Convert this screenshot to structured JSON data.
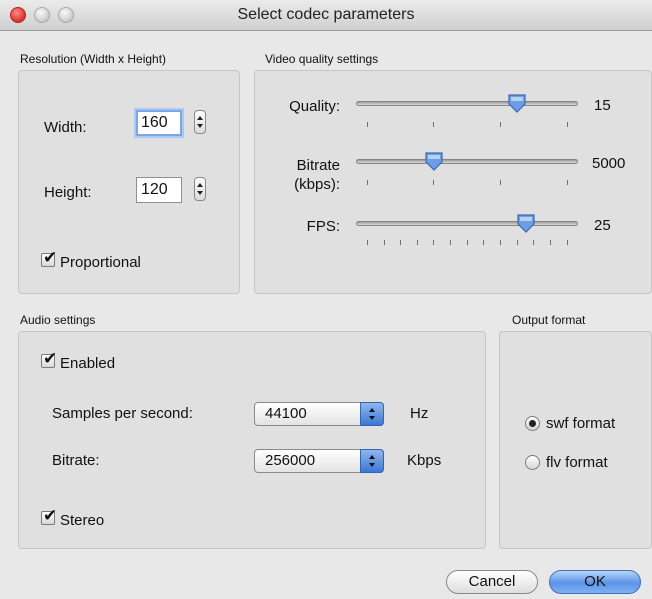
{
  "window": {
    "title": "Select codec parameters"
  },
  "resolution": {
    "group_label": "Resolution (Width x Height)",
    "width_label": "Width:",
    "width_value": "160",
    "height_label": "Height:",
    "height_value": "120",
    "proportional_label": "Proportional",
    "proportional_checked": true
  },
  "video": {
    "group_label": "Video quality settings",
    "quality_label": "Quality:",
    "quality_value": "15",
    "bitrate_label_line1": "Bitrate",
    "bitrate_label_line2": "(kbps):",
    "bitrate_value": "5000",
    "fps_label": "FPS:",
    "fps_value": "25"
  },
  "audio": {
    "group_label": "Audio settings",
    "enabled_label": "Enabled",
    "enabled_checked": true,
    "samples_label": "Samples per second:",
    "samples_value": "44100",
    "samples_unit": "Hz",
    "bitrate_label": "Bitrate:",
    "bitrate_value": "256000",
    "bitrate_unit": "Kbps",
    "stereo_label": "Stereo",
    "stereo_checked": true
  },
  "output": {
    "group_label": "Output format",
    "options": [
      "swf format",
      "flv format"
    ],
    "selected": "swf format"
  },
  "buttons": {
    "cancel": "Cancel",
    "ok": "OK"
  },
  "colors": {
    "accent": "#5b95e6",
    "close": "#d8302a"
  },
  "icons": {
    "checkmark": "✔",
    "stepper": "up-down-arrows"
  }
}
